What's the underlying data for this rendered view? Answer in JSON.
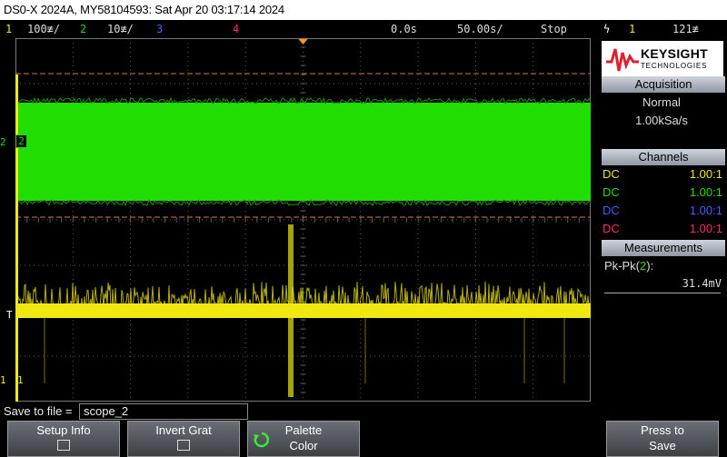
{
  "title": "DS0-X 2024A, MY58104593: Sat Apr 20 03:17:14 2024",
  "status": {
    "ch1_num": "1",
    "ch1_scale": "100≢/",
    "ch2_num": "2",
    "ch2_scale": "10≢/",
    "ch3_num": "3",
    "ch4_num": "4",
    "time_delay": "0.0s",
    "time_scale": "50.00s/",
    "run_state": "Stop",
    "trigger_icon": "ϟ",
    "trigger_source": "1",
    "trigger_level": "121≢"
  },
  "colors": {
    "ch1": "#f0e810",
    "ch2": "#22dd00",
    "ch3": "#4b5cff",
    "ch4": "#ff2a6a",
    "grid": "#5a5a5a"
  },
  "markers": {
    "ch2_ground": "2",
    "ch2_label": "2",
    "trigger_T": "T",
    "ch1_ground": "1",
    "ch1_label": "1"
  },
  "logo": {
    "name": "KEYSIGHT",
    "sub": "TECHNOLOGIES"
  },
  "acquisition": {
    "header": "Acquisition",
    "mode": "Normal",
    "rate": "1.00kSa/s"
  },
  "channels": {
    "header": "Channels",
    "rows": [
      {
        "coupling": "DC",
        "probe": "1.00:1",
        "color": "#f0e810"
      },
      {
        "coupling": "DC",
        "probe": "1.00:1",
        "color": "#22dd00"
      },
      {
        "coupling": "DC",
        "probe": "1.00:1",
        "color": "#4b5cff"
      },
      {
        "coupling": "DC",
        "probe": "1.00:1",
        "color": "#ff2a6a"
      }
    ]
  },
  "measurements": {
    "header": "Measurements",
    "label_prefix": "Pk-Pk(",
    "label_ch": "2",
    "label_suffix": "):",
    "value": "31.4mV"
  },
  "save": {
    "label": "Save to file =",
    "filename": "scope_2"
  },
  "softkeys": {
    "setup_info": "Setup Info",
    "invert_grat": "Invert Grat",
    "palette_line1": "Palette",
    "palette_line2": "Color",
    "press_line1": "Press to",
    "press_line2": "Save"
  }
}
